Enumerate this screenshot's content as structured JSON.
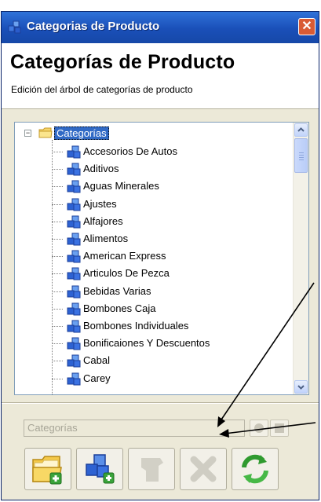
{
  "window": {
    "title": "Categorias de Producto",
    "close_glyph": "✕"
  },
  "header": {
    "title": "Categorías de Producto",
    "subtitle": "Edición del árbol de categorías de producto"
  },
  "tree": {
    "root": {
      "label": "Categorías",
      "expander": "−",
      "icon": "folder-icon",
      "selected": true
    },
    "items": [
      {
        "label": "Accesorios De Autos",
        "icon": "category-cubes-icon"
      },
      {
        "label": "Aditivos",
        "icon": "category-cubes-icon"
      },
      {
        "label": "Aguas Minerales",
        "icon": "category-cubes-icon"
      },
      {
        "label": "Ajustes",
        "icon": "category-cubes-icon"
      },
      {
        "label": "Alfajores",
        "icon": "category-cubes-icon"
      },
      {
        "label": "Alimentos",
        "icon": "category-cubes-icon"
      },
      {
        "label": "American Express",
        "icon": "category-cubes-icon"
      },
      {
        "label": "Articulos De Pezca",
        "icon": "category-cubes-icon"
      },
      {
        "label": "Bebidas Varias",
        "icon": "category-cubes-icon"
      },
      {
        "label": "Bombones Caja",
        "icon": "category-cubes-icon"
      },
      {
        "label": "Bombones Individuales",
        "icon": "category-cubes-icon"
      },
      {
        "label": "Bonificaiones Y Descuentos",
        "icon": "category-cubes-icon"
      },
      {
        "label": "Cabal",
        "icon": "category-cubes-icon"
      },
      {
        "label": "Carey",
        "icon": "category-cubes-icon"
      }
    ]
  },
  "editor": {
    "name_value": "Categorías",
    "confirm_icon": "circle-icon",
    "cancel_icon": "square-icon"
  },
  "toolbar": {
    "buttons": [
      {
        "name": "add-folder",
        "icon": "folder-add-icon",
        "enabled": true
      },
      {
        "name": "add-category",
        "icon": "cubes-add-icon",
        "enabled": true
      },
      {
        "name": "edit",
        "icon": "edit-icon",
        "enabled": false
      },
      {
        "name": "delete",
        "icon": "delete-x-icon",
        "enabled": false
      },
      {
        "name": "refresh",
        "icon": "refresh-icon",
        "enabled": true
      }
    ]
  },
  "colors": {
    "titlebar": "#1a4fb8",
    "selection": "#316ac5",
    "window_bg": "#ece9d8",
    "close_button": "#d95b34"
  }
}
